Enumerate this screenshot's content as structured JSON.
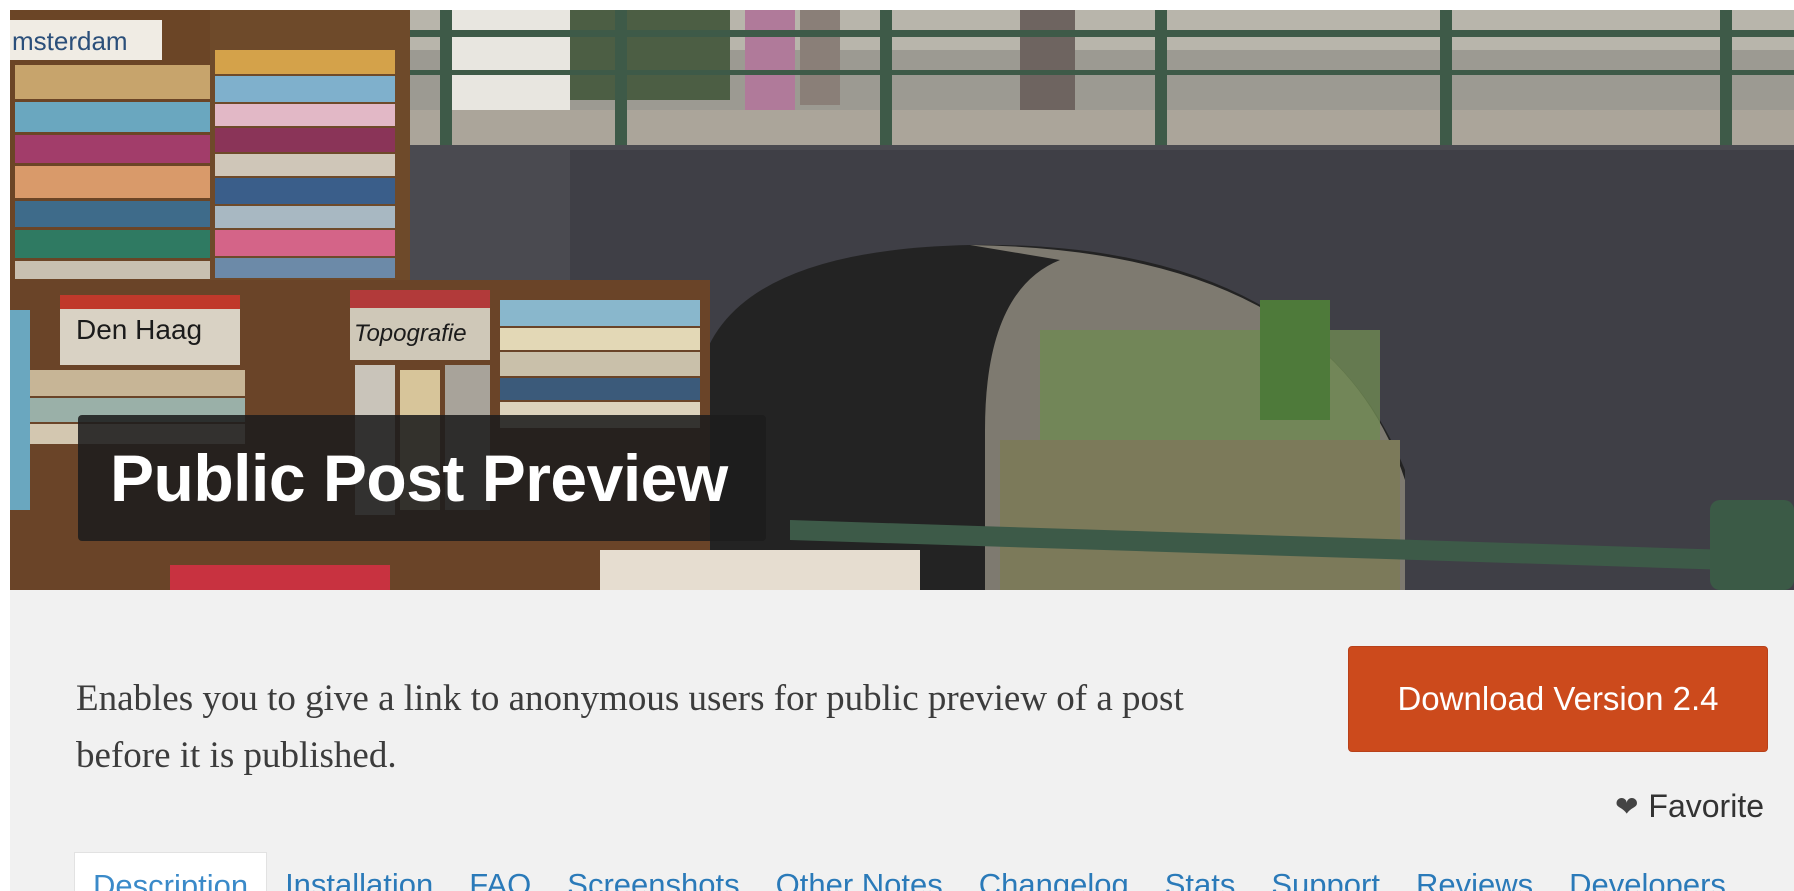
{
  "banner": {
    "title": "Public Post Preview",
    "sign_amsterdam": "msterdam",
    "sign_den_haag": "Den Haag",
    "sign_topografie": "Topografie"
  },
  "description": "Enables you to give a link to anonymous users for public preview of a post before it is published.",
  "download_button": "Download Version 2.4",
  "favorite": {
    "icon": "heart-icon",
    "label": "Favorite"
  },
  "tabs": [
    {
      "label": "Description",
      "active": true
    },
    {
      "label": "Installation"
    },
    {
      "label": "FAQ"
    },
    {
      "label": "Screenshots"
    },
    {
      "label": "Other Notes"
    },
    {
      "label": "Changelog"
    },
    {
      "label": "Stats"
    },
    {
      "label": "Support"
    },
    {
      "label": "Reviews"
    },
    {
      "label": "Developers"
    }
  ],
  "colors": {
    "accent": "#cc4a1c",
    "link": "#2a7ab9",
    "background": "#f1f1f1"
  }
}
